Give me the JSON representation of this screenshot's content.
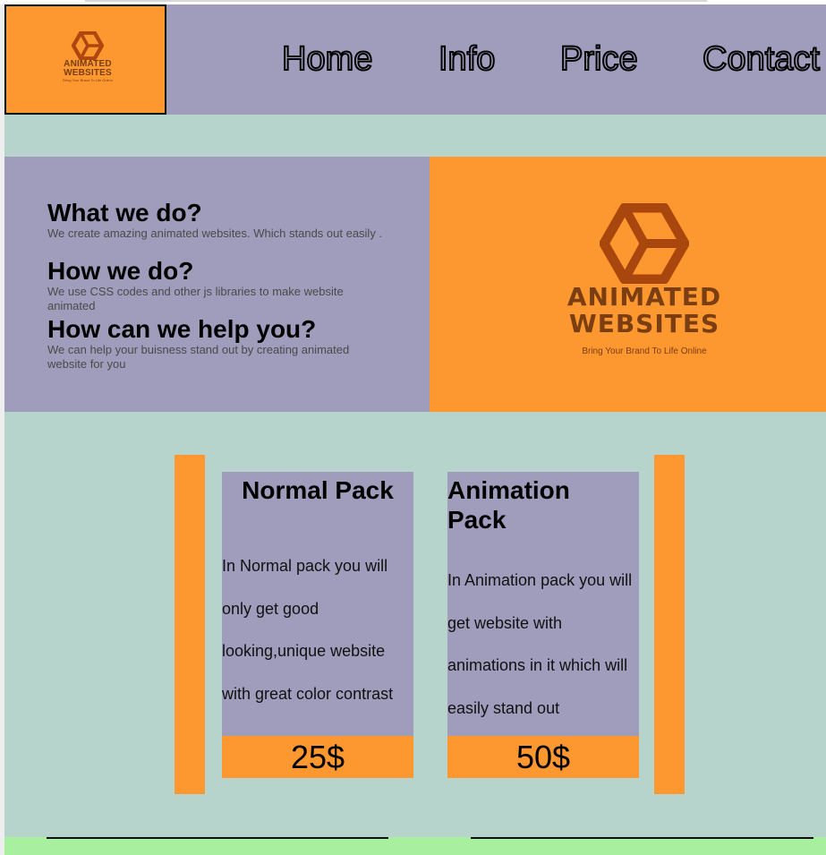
{
  "brand": {
    "line1": "ANIMATED",
    "line2": "WEBSITES",
    "tagline": "Bring Your Brand To Life Online"
  },
  "nav": {
    "items": [
      "Home",
      "Info",
      "Price",
      "Contact"
    ]
  },
  "info": {
    "q1": "What we do?",
    "a1": "We create amazing animated websites. Which stands out easily .",
    "q2": "How we do?",
    "a2": "We use CSS codes and other js libraries to make website animated",
    "q3": "How can we help you?",
    "a3": "We can help your buisness stand out by creating animated website for you"
  },
  "pricing": {
    "cards": [
      {
        "title": "Normal Pack",
        "description": "In Normal pack you will only get good looking,unique website with great color contrast",
        "price": "25$"
      },
      {
        "title": "Animation Pack",
        "description": "In Animation pack you will get website with animations in it which will easily stand out",
        "price": "50$"
      }
    ]
  },
  "colors": {
    "orange": "#fd972f",
    "lavender": "#a09cbc",
    "mint": "#b6d4cc",
    "logo_brown": "#7a3e12"
  }
}
